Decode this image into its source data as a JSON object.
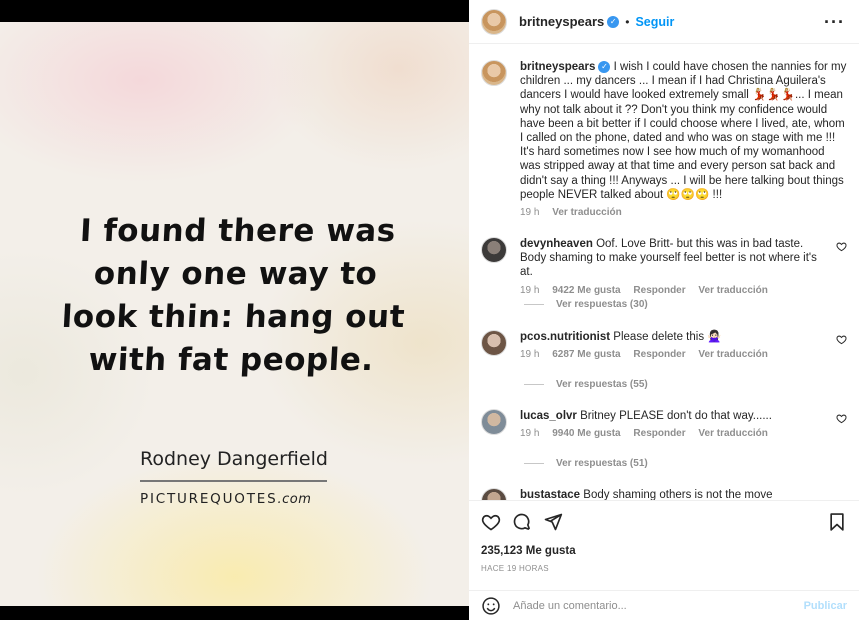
{
  "post_image": {
    "quote_lines": [
      "I found there was",
      "only one way to",
      "look thin: hang out",
      "with fat people."
    ],
    "author": "Rodney Dangerfield",
    "brand_main": "PICTUREQUOTES",
    "brand_suffix": ".com"
  },
  "header": {
    "username": "britneyspears",
    "verified": true,
    "separator": "•",
    "follow_label": "Seguir",
    "more_icon": "more-horizontal-icon"
  },
  "caption": {
    "username": "britneyspears",
    "text": "I wish I could have chosen the nannies for my children ... my dancers ... I mean if I had Christina Aguilera's dancers I would have looked extremely small 💃🏼💃🏼💃🏼... I mean why not talk about it ?? Don't you think my confidence would have been a bit better if I could choose where I lived, ate, whom I called on the phone, dated and who was on stage with me !!! It's hard sometimes now I see how much of my womanhood was stripped away at that time and every person sat back and didn't say a thing !!! Anyways ... I will be here talking bout things people NEVER talked about 🙄🙄🙄 !!!",
    "time": "19 h",
    "translate": "Ver traducción"
  },
  "comments": [
    {
      "username": "devynheaven",
      "text": "Oof. Love Britt- but this was in bad taste. Body shaming to make yourself feel better is not where it's at.",
      "time": "19 h",
      "likes": "9422 Me gusta",
      "reply": "Responder",
      "translate": "Ver traducción",
      "replies": "Ver respuestas (30)"
    },
    {
      "username": "pcos.nutritionist",
      "text": "Please delete this 🙅🏻‍♀️",
      "time": "19 h",
      "likes": "6287 Me gusta",
      "reply": "Responder",
      "translate": "Ver traducción",
      "replies": "Ver respuestas (55)"
    },
    {
      "username": "lucas_olvr",
      "text": "Britney PLEASE don't do that way......",
      "time": "19 h",
      "likes": "9940 Me gusta",
      "reply": "Responder",
      "translate": "Ver traducción",
      "replies": "Ver respuestas (51)"
    },
    {
      "username": "bustastace",
      "text": "Body shaming others is not the move"
    }
  ],
  "actions": {
    "likes": "235,123 Me gusta",
    "time_ago": "HACE 19 HORAS"
  },
  "comment_bar": {
    "placeholder": "Añade un comentario...",
    "publish": "Publicar"
  },
  "colors": {
    "accent": "#0095f6",
    "publish_disabled": "#b2dffc",
    "verified": "#3897f0"
  }
}
